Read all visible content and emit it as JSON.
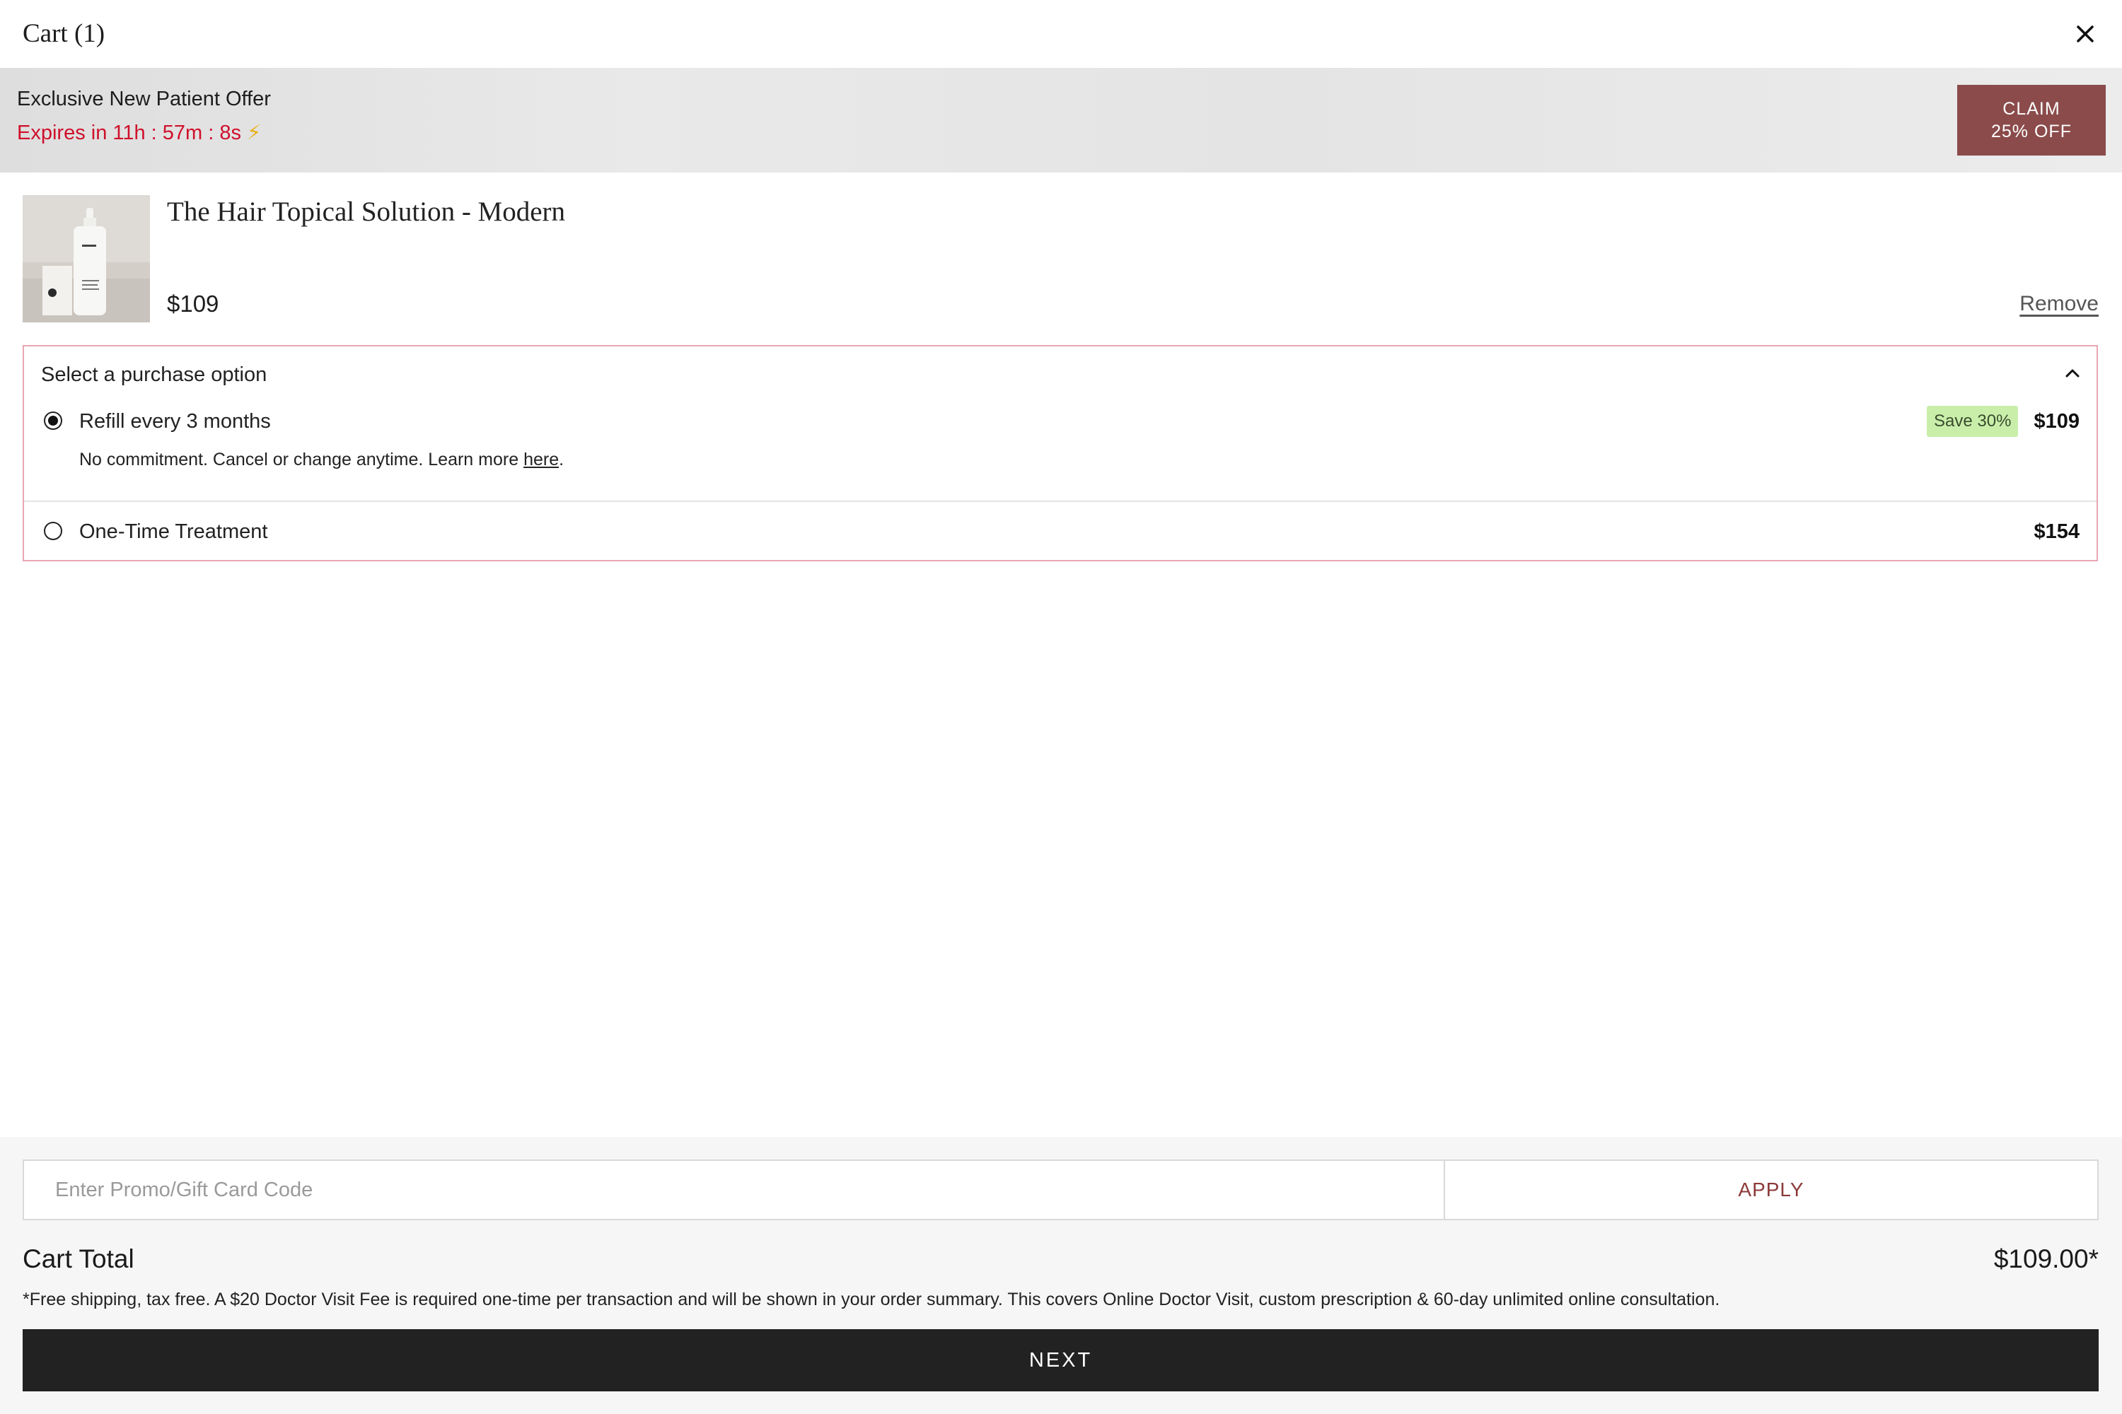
{
  "header": {
    "title": "Cart (1)",
    "close_icon": "close-icon"
  },
  "offer": {
    "title": "Exclusive New Patient Offer",
    "timer": "Expires in 11h : 57m : 8s",
    "bolt_icon": "⚡",
    "claim_line1": "CLAIM",
    "claim_line2": "25% OFF",
    "claim_color": "#8b4b4b",
    "timer_color": "#d0102b"
  },
  "product": {
    "name": "The Hair Topical Solution - Modern",
    "price": "$109",
    "remove_label": "Remove",
    "image_icon": "product-bottle-image"
  },
  "purchase_options": {
    "heading": "Select a purchase option",
    "options": [
      {
        "label": "Refill every 3 months",
        "note_prefix": "No commitment. Cancel or change anytime. Learn more ",
        "note_link": "here",
        "note_suffix": ".",
        "badge": "Save 30%",
        "price": "$109",
        "selected": true
      },
      {
        "label": "One-Time Treatment",
        "price": "$154",
        "selected": false
      }
    ]
  },
  "footer": {
    "promo_placeholder": "Enter Promo/Gift Card Code",
    "apply_label": "APPLY",
    "total_label": "Cart Total",
    "total_value": "$109.00*",
    "disclaimer": "*Free shipping, tax free. A $20 Doctor Visit Fee is required one-time per transaction and will be shown in your order summary. This covers Online Doctor Visit, custom prescription & 60-day unlimited online consultation.",
    "next_label": "NEXT"
  }
}
